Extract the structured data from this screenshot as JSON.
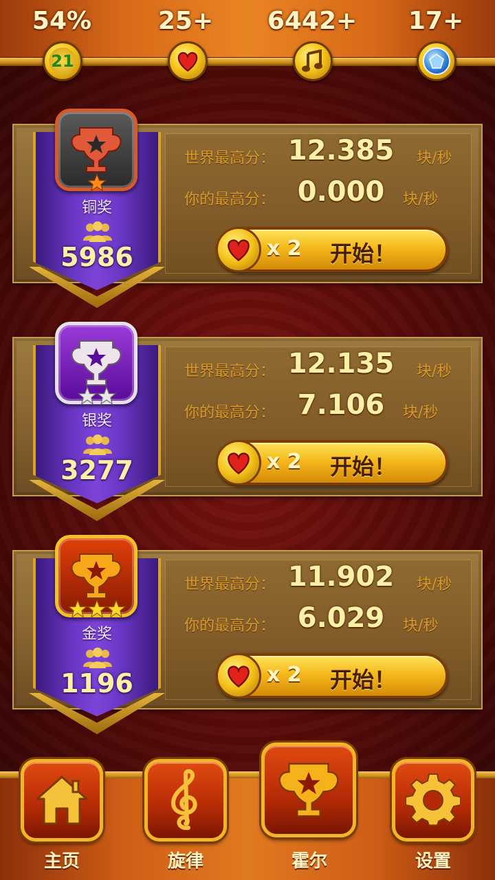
{
  "top_stats": [
    {
      "name": "progress",
      "label": "54%",
      "badge": "21",
      "icon": "level-badge-icon"
    },
    {
      "name": "lives",
      "label": "25+",
      "icon": "heart-icon"
    },
    {
      "name": "notes",
      "label": "6442+",
      "icon": "music-note-icon"
    },
    {
      "name": "gems",
      "label": "17+",
      "icon": "gem-icon"
    }
  ],
  "awards": [
    {
      "name": "铜奖",
      "players": "5986",
      "world_label": "世界最高分：",
      "world_value": "12.385",
      "my_label": "你的最高分：",
      "my_value": "0.000",
      "unit": "块/秒",
      "cost": "x 2",
      "start": "开始！",
      "stars": 1,
      "color": "#c04a2a"
    },
    {
      "name": "银奖",
      "players": "3277",
      "world_label": "世界最高分：",
      "world_value": "12.135",
      "my_label": "你的最高分：",
      "my_value": "7.106",
      "unit": "块/秒",
      "cost": "x 2",
      "start": "开始！",
      "stars": 2,
      "color": "#d8d0d8"
    },
    {
      "name": "金奖",
      "players": "1196",
      "world_label": "世界最高分：",
      "world_value": "11.902",
      "my_label": "你的最高分：",
      "my_value": "6.029",
      "unit": "块/秒",
      "cost": "x 2",
      "start": "开始！",
      "stars": 3,
      "color": "#f0a41a"
    }
  ],
  "nav": [
    {
      "label": "主页",
      "icon": "home-icon"
    },
    {
      "label": "旋律",
      "icon": "treble-clef-icon"
    },
    {
      "label": "霍尔",
      "icon": "trophy-icon",
      "active": true
    },
    {
      "label": "设置",
      "icon": "gear-icon"
    }
  ]
}
